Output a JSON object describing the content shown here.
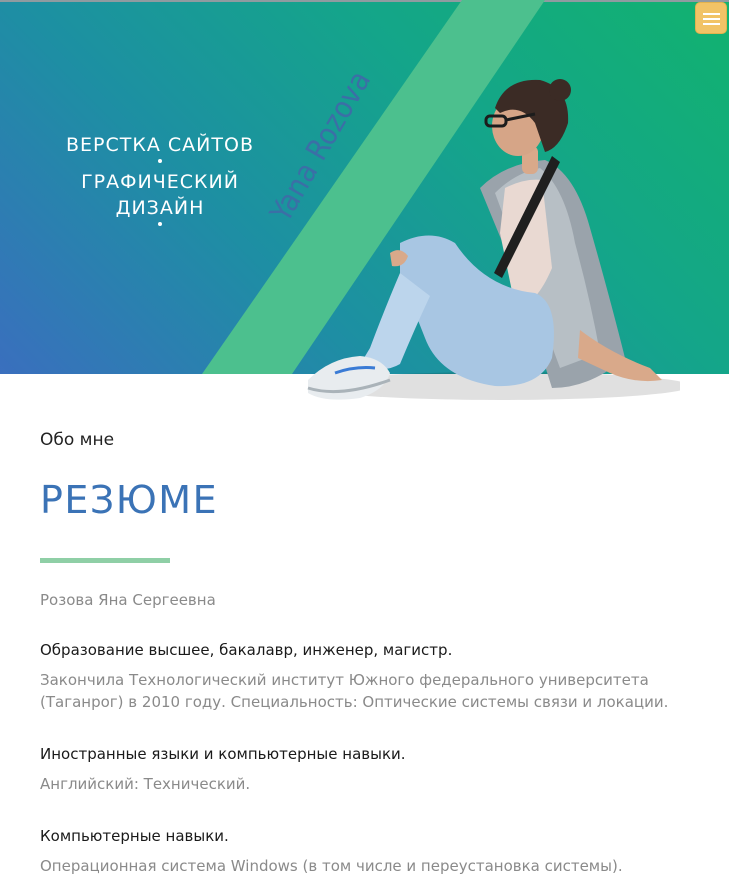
{
  "hero": {
    "services": [
      "Верстка сайтов",
      "Графический дизайн"
    ],
    "signature": "Yana Rozova",
    "colors": {
      "green": "#12b26f",
      "blue": "#3a6fbe",
      "stripe": "#4cc08e",
      "accent": "#f1c366"
    }
  },
  "menu": {
    "icon": "hamburger-menu-icon"
  },
  "resume": {
    "about_label": "Обо мне",
    "title": "Резюме",
    "name": "Розова Яна Сергеевна",
    "education_heading": "Образование высшее, бакалавр, инженер, магистр.",
    "education_text": "Закончила Технологический институт Южного федерального университета (Таганрог) в 2010 году. Специальность: Оптические системы связи и локации.",
    "languages_heading": "Иностранные языки и компьютерные навыки.",
    "languages_text": "Английский: Технический.",
    "skills_heading": "Компьютерные навыки.",
    "skills_text": "Операционная система Windows (в том числе и переустановка системы). Верстка страниц сайтов в редакторе VS Code (html, scc, scss). Работа в программе Adobe Photoshop (дизайн сайтов, графический дизайн)."
  }
}
